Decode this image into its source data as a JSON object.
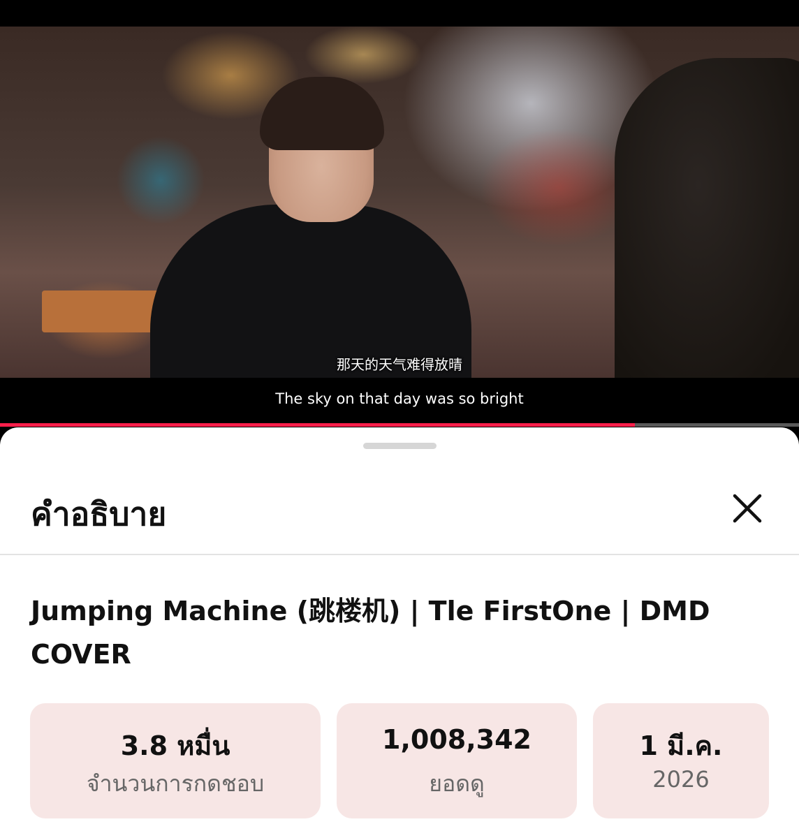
{
  "video": {
    "subtitle_cn": "那天的天气难得放晴",
    "subtitle_en": "The sky on that day was so bright",
    "progress": 0.795,
    "progress_color": "#ff1f4b"
  },
  "sheet": {
    "title": "คำอธิบาย",
    "close_icon": "close-icon",
    "video_title": "Jumping Machine (跳楼机) | Tle FirstOne | DMD COVER",
    "stats": [
      {
        "value": "3.8 หมื่น",
        "label": "จำนวนการกดชอบ"
      },
      {
        "value": "1,008,342",
        "label": "ยอดดู"
      },
      {
        "value": "1 มี.ค.",
        "label": "2026"
      }
    ],
    "stat_bg_color": "#f7e6e5"
  }
}
